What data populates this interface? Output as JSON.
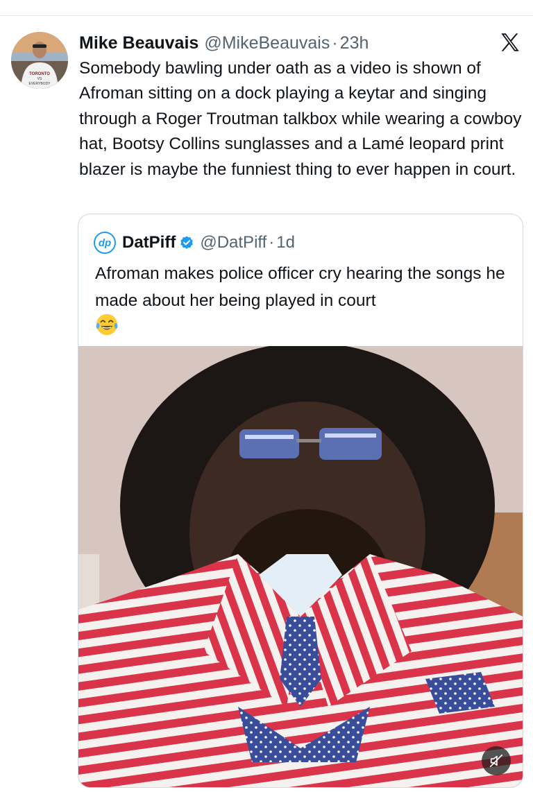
{
  "tweet": {
    "author_name": "Mike Beauvais",
    "handle": "@MikeBeauvais",
    "separator": "·",
    "time": "23h",
    "text": "Somebody bawling under oath as a video is shown of Afroman sitting on a dock playing a keytar and singing through a Roger Troutman talkbox while wearing a cowboy hat, Bootsy Collins sunglasses and a Lamé leopard print blazer is maybe the funniest thing to ever happen in court.",
    "avatar_shirt_text": "TORONTO VS EVERYBODY"
  },
  "quote": {
    "avatar_text": "dp",
    "author_name": "DatPiff",
    "verified": true,
    "handle": "@DatPiff",
    "separator": "·",
    "time": "1d",
    "text": "Afroman makes police officer cry hearing the songs he made about her being played in court",
    "emoji": "face-with-tears-of-joy"
  },
  "icons": {
    "platform_logo": "x-logo-icon",
    "verified_badge": "verified-badge-icon",
    "mute": "speaker-muted-icon"
  },
  "colors": {
    "accent": "#1d9bf0",
    "text_primary": "#0f1419",
    "text_secondary": "#536471",
    "border": "#cfd9de"
  }
}
